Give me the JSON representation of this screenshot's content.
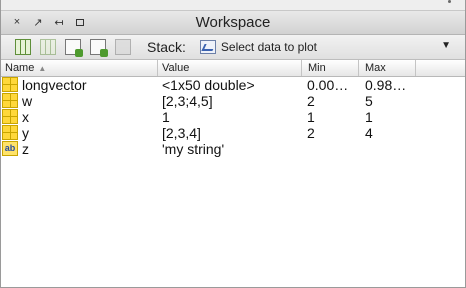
{
  "window": {
    "title": "Workspace",
    "controls": [
      "×",
      "↗",
      "↤",
      "□"
    ]
  },
  "toolbar": {
    "stack_label": "Stack:",
    "plot_label": "Select data to plot",
    "dropdown_glyph": "▼"
  },
  "table": {
    "headers": [
      "Name",
      "Value",
      "Min",
      "Max"
    ],
    "sort_indicator": "▲",
    "rows": [
      {
        "icon": "matrix-icon",
        "name": "longvector",
        "value": "<1x50 double>",
        "min": "0.00…",
        "max": "0.98…"
      },
      {
        "icon": "matrix-icon",
        "name": "w",
        "value": "[2,3;4,5]",
        "min": "2",
        "max": "5"
      },
      {
        "icon": "matrix-icon",
        "name": "x",
        "value": "1",
        "min": "1",
        "max": "1"
      },
      {
        "icon": "matrix-icon",
        "name": "y",
        "value": "[2,3,4]",
        "min": "2",
        "max": "4"
      },
      {
        "icon": "string-icon",
        "name": "z",
        "value": "'my string'",
        "min": "",
        "max": ""
      }
    ]
  },
  "icons": {
    "string_icon_text": "ab"
  },
  "colors": {
    "icon_fill": "#ffd83a",
    "icon_border": "#c9a500"
  }
}
